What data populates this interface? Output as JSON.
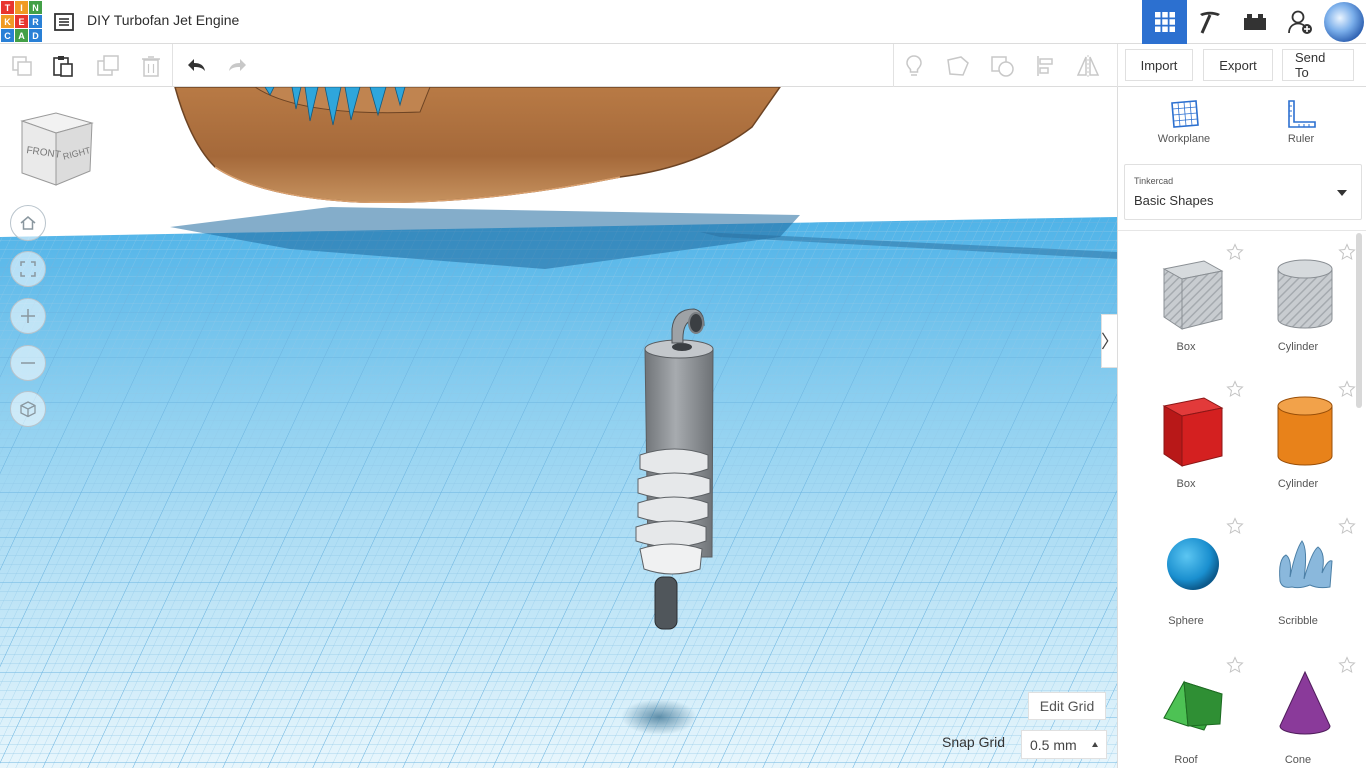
{
  "app": {
    "logo_letters": [
      "T",
      "I",
      "N",
      "K",
      "E",
      "R",
      "C",
      "A",
      "D"
    ],
    "logo_colors": [
      "#e8352d",
      "#f09a23",
      "#43a047",
      "#f09a23",
      "#e8352d",
      "#2980d6",
      "#2980d6",
      "#43a047",
      "#2980d6"
    ],
    "document_title": "DIY Turbofan Jet Engine",
    "accent": "#2c70d0"
  },
  "topbar": {
    "icons": [
      "grid-view-icon",
      "pickaxe-icon",
      "bricks-icon",
      "add-user-icon",
      "avatar"
    ]
  },
  "toolbar": {
    "tools": [
      "copy-icon",
      "paste-icon",
      "duplicate-icon",
      "delete-icon",
      "undo-icon",
      "redo-icon"
    ],
    "right_tools": [
      "lightbulb-icon",
      "note-icon",
      "shape-group-icon",
      "align-icon",
      "mirror-icon"
    ],
    "import_label": "Import",
    "export_label": "Export",
    "send_to_label": "Send To"
  },
  "viewport": {
    "viewcube_front": "FRONT",
    "viewcube_right": "RIGHT",
    "nav_buttons": [
      "home-view",
      "fit-view",
      "zoom-in",
      "zoom-out",
      "orthographic-view"
    ],
    "edit_grid_label": "Edit Grid",
    "snap_grid_label": "Snap Grid",
    "snap_grid_value": "0.5 mm",
    "collapse_glyph": "〉"
  },
  "panel": {
    "workplane_label": "Workplane",
    "ruler_label": "Ruler",
    "library_owner": "Tinkercad",
    "library_name": "Basic Shapes",
    "shapes": [
      {
        "label": "Box",
        "color": "#b8bcc2"
      },
      {
        "label": "Cylinder",
        "color": "#b8bcc2"
      },
      {
        "label": "Box",
        "color": "#d42020"
      },
      {
        "label": "Cylinder",
        "color": "#e8821a"
      },
      {
        "label": "Sphere",
        "color": "#1a8fcf"
      },
      {
        "label": "Scribble",
        "color": "#8ab8dc"
      },
      {
        "label": "Roof",
        "color": "#3aa840"
      },
      {
        "label": "Cone",
        "color": "#8a3a9a"
      }
    ]
  }
}
